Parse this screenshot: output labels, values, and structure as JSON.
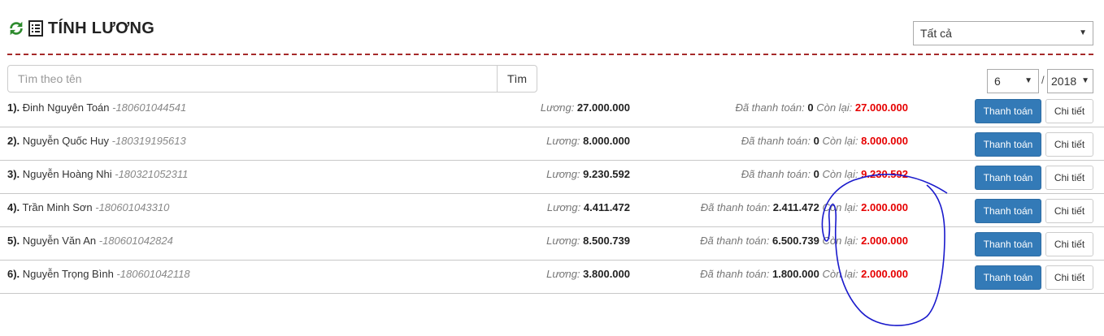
{
  "header": {
    "title": "TÍNH LƯƠNG"
  },
  "filter": {
    "selected": "Tất cả"
  },
  "search": {
    "placeholder": "Tìm theo tên",
    "button_label": "Tìm"
  },
  "period": {
    "month": "6",
    "separator": "/",
    "year": "2018"
  },
  "labels": {
    "salary": "Lương: ",
    "paid": "Đã thanh toán: ",
    "remaining": "Còn lại: ",
    "pay_button": "Thanh toán",
    "detail_button": "Chi tiết"
  },
  "colors": {
    "accent_red": "#e60000",
    "primary_blue": "#337ab7",
    "divider": "#a52a2a",
    "refresh_green": "#2e8b2e",
    "annotation_blue": "#1a1acc"
  },
  "employees": [
    {
      "index": "1).",
      "name": " Đinh Nguyên Toán ",
      "code": "-180601044541",
      "salary": "27.000.000",
      "paid": "0",
      "remaining": "27.000.000"
    },
    {
      "index": "2).",
      "name": " Nguyễn Quốc Huy ",
      "code": "-180319195613",
      "salary": "8.000.000",
      "paid": "0",
      "remaining": "8.000.000"
    },
    {
      "index": "3).",
      "name": " Nguyễn Hoàng Nhi ",
      "code": "-180321052311",
      "salary": "9.230.592",
      "paid": "0",
      "remaining": "9.230.592"
    },
    {
      "index": "4).",
      "name": " Trần Minh Sơn ",
      "code": "-180601043310",
      "salary": "4.411.472",
      "paid": "2.411.472",
      "remaining": "2.000.000"
    },
    {
      "index": "5).",
      "name": " Nguyễn Văn An ",
      "code": "-180601042824",
      "salary": "8.500.739",
      "paid": "6.500.739",
      "remaining": "2.000.000"
    },
    {
      "index": "6).",
      "name": " Nguyễn Trọng Bình ",
      "code": "-180601042118",
      "salary": "3.800.000",
      "paid": "1.800.000",
      "remaining": "2.000.000"
    }
  ]
}
